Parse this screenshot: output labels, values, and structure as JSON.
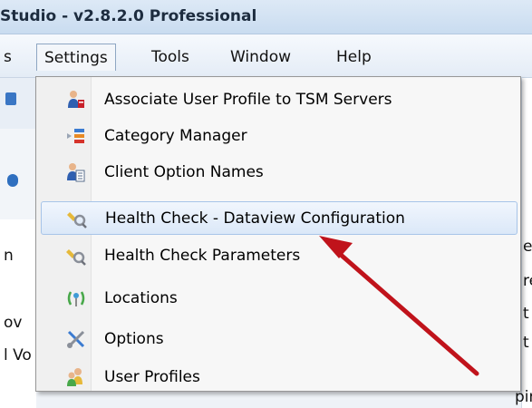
{
  "window": {
    "title": "Studio - v2.8.2.0 Professional"
  },
  "menubar": {
    "items": [
      {
        "label": "s"
      },
      {
        "label": "Settings"
      },
      {
        "label": "Tools"
      },
      {
        "label": "Window"
      },
      {
        "label": "Help"
      }
    ]
  },
  "settings_menu": {
    "items": [
      {
        "label": "Associate User Profile to TSM Servers",
        "icon": "user-server-icon"
      },
      {
        "label": "Category Manager",
        "icon": "category-icon"
      },
      {
        "label": "Client Option Names",
        "icon": "client-options-icon"
      },
      {
        "label": "Health Check - Dataview Configuration",
        "icon": "health-check-icon"
      },
      {
        "label": "Health Check Parameters",
        "icon": "health-check-params-icon"
      },
      {
        "label": "Locations",
        "icon": "locations-icon"
      },
      {
        "label": "Options",
        "icon": "tools-icon"
      },
      {
        "label": "User Profiles",
        "icon": "users-icon"
      }
    ],
    "highlighted": "Health Check - Dataview Configuration"
  },
  "background": {
    "fragments": [
      "n",
      "ov",
      "l Vo",
      "ea",
      "re",
      "t",
      "t",
      "pir"
    ]
  },
  "colors": {
    "highlight": "#dbe8f8",
    "arrow": "#c0131b"
  }
}
